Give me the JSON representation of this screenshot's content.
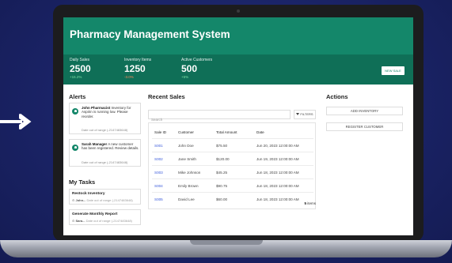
{
  "app": {
    "title": "Pharmacy Management System"
  },
  "stats": [
    {
      "label": "Daily Sales",
      "value": "2500",
      "change": "+15.2%"
    },
    {
      "label": "Inventory Items",
      "value": "1250",
      "change": "-3.0%"
    },
    {
      "label": "Active Customers",
      "value": "500",
      "change": "+5%"
    }
  ],
  "header_actions": {
    "new_sale": "NEW SALE"
  },
  "alerts": {
    "title": "Alerts",
    "items": [
      {
        "name": "John Pharmacist",
        "message": "Inventory for Aspirin is running low. Please reorder.",
        "date": "Date out of range (-2147483648)"
      },
      {
        "name": "Sarah Manager",
        "message": "A new customer has been registered. Review details.",
        "date": "Date out of range (-2147483648)"
      }
    ]
  },
  "tasks": {
    "title": "My Tasks",
    "items": [
      {
        "title": "Restock Inventory",
        "assignee": "John...",
        "date": "Date out of range (-2147483648)"
      },
      {
        "title": "Generate Monthly Report",
        "assignee": "Sara...",
        "date": "Date out of range (-2147483648)"
      }
    ]
  },
  "sales": {
    "title": "Recent Sales",
    "search_placeholder": "Search",
    "filters_label": "FILTERS",
    "columns": [
      "Sale ID",
      "Customer",
      "Total Amount",
      "Date"
    ],
    "rows": [
      [
        "S001",
        "John Doe",
        "$75.50",
        "Jun 20, 2023 12:00:00 AM"
      ],
      [
        "S002",
        "Jane Smith",
        "$120.00",
        "Jun 19, 2023 12:00:00 AM"
      ],
      [
        "S003",
        "Mike Johnson",
        "$45.25",
        "Jun 18, 2023 12:00:00 AM"
      ],
      [
        "S004",
        "Emily Brown",
        "$90.75",
        "Jun 18, 2023 12:00:00 AM"
      ],
      [
        "S005",
        "David Lee",
        "$60.00",
        "Jun 18, 2023 12:00:00 AM"
      ]
    ],
    "count": "5",
    "count_label": "items"
  },
  "actions": {
    "title": "Actions",
    "add_inventory": "ADD INVENTORY",
    "register_customer": "REGISTER CUSTOMER"
  },
  "colors": {
    "primary": "#14876a",
    "primary_dark": "#0f6f57",
    "link": "#3b5bdb",
    "background": "#1a2366"
  }
}
